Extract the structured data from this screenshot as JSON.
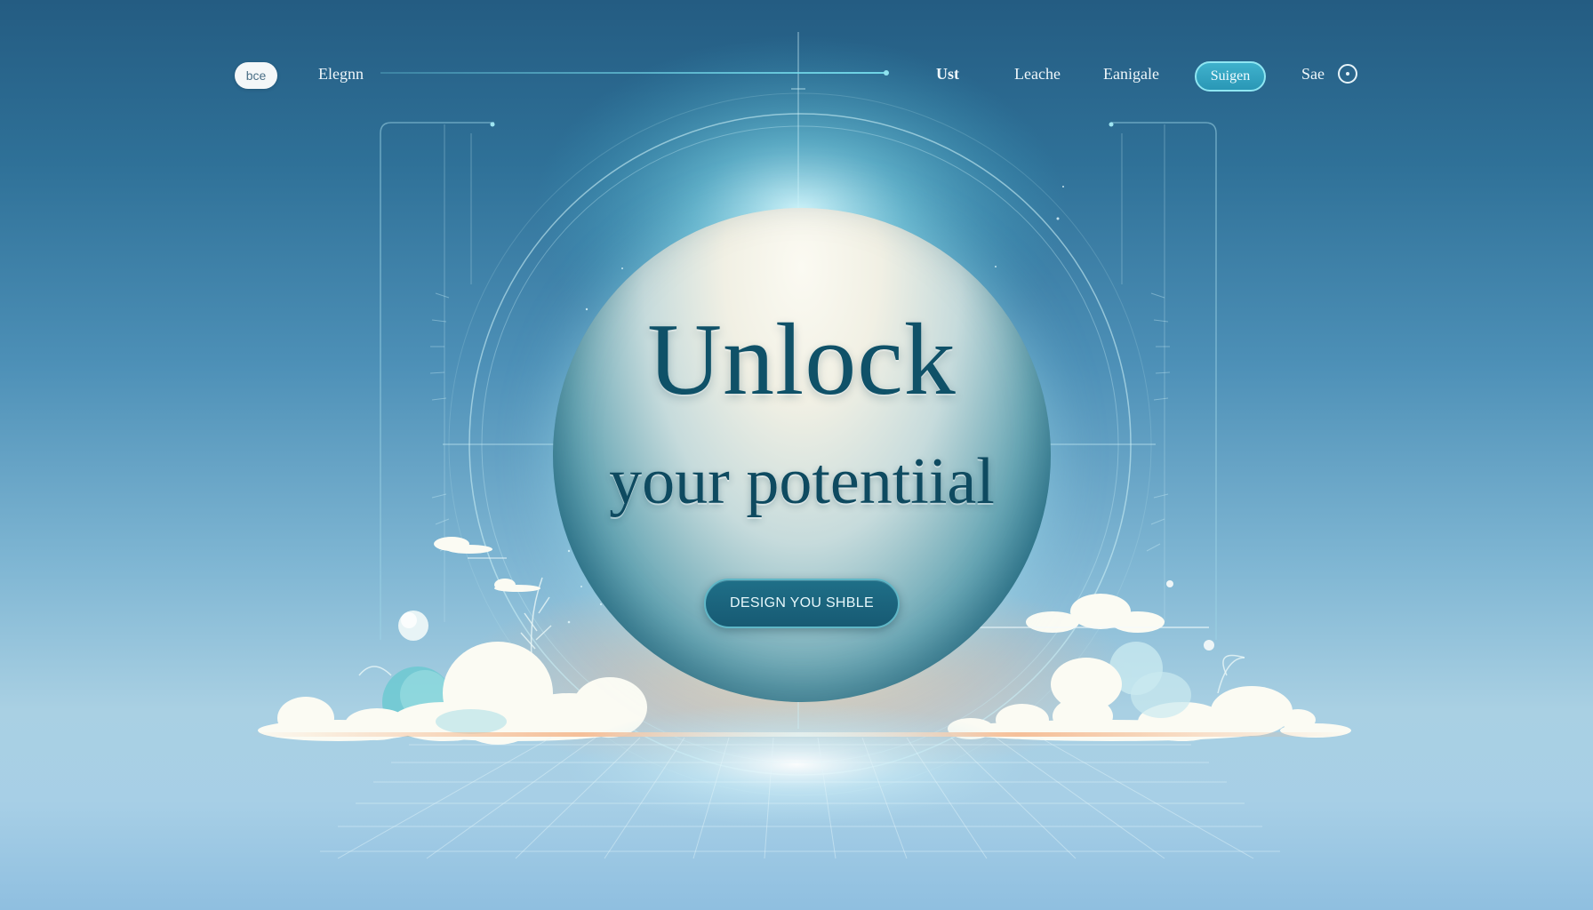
{
  "nav": {
    "logo_text": "bce",
    "brand": "Elegnn",
    "links": [
      "Ust",
      "Leache",
      "Eanigale"
    ],
    "signup_button": "Suigen",
    "last_link": "Sae"
  },
  "hero": {
    "title": "Unlock",
    "subtitle": "your potentiial",
    "cta_label": "DESIGN YOU SHBLE"
  },
  "colors": {
    "background_top": "#245c82",
    "background_bottom": "#8fbfe0",
    "accent_cyan": "#3fb1cc",
    "title_teal": "#0f5168",
    "cta_fill": "#1f6f88"
  }
}
